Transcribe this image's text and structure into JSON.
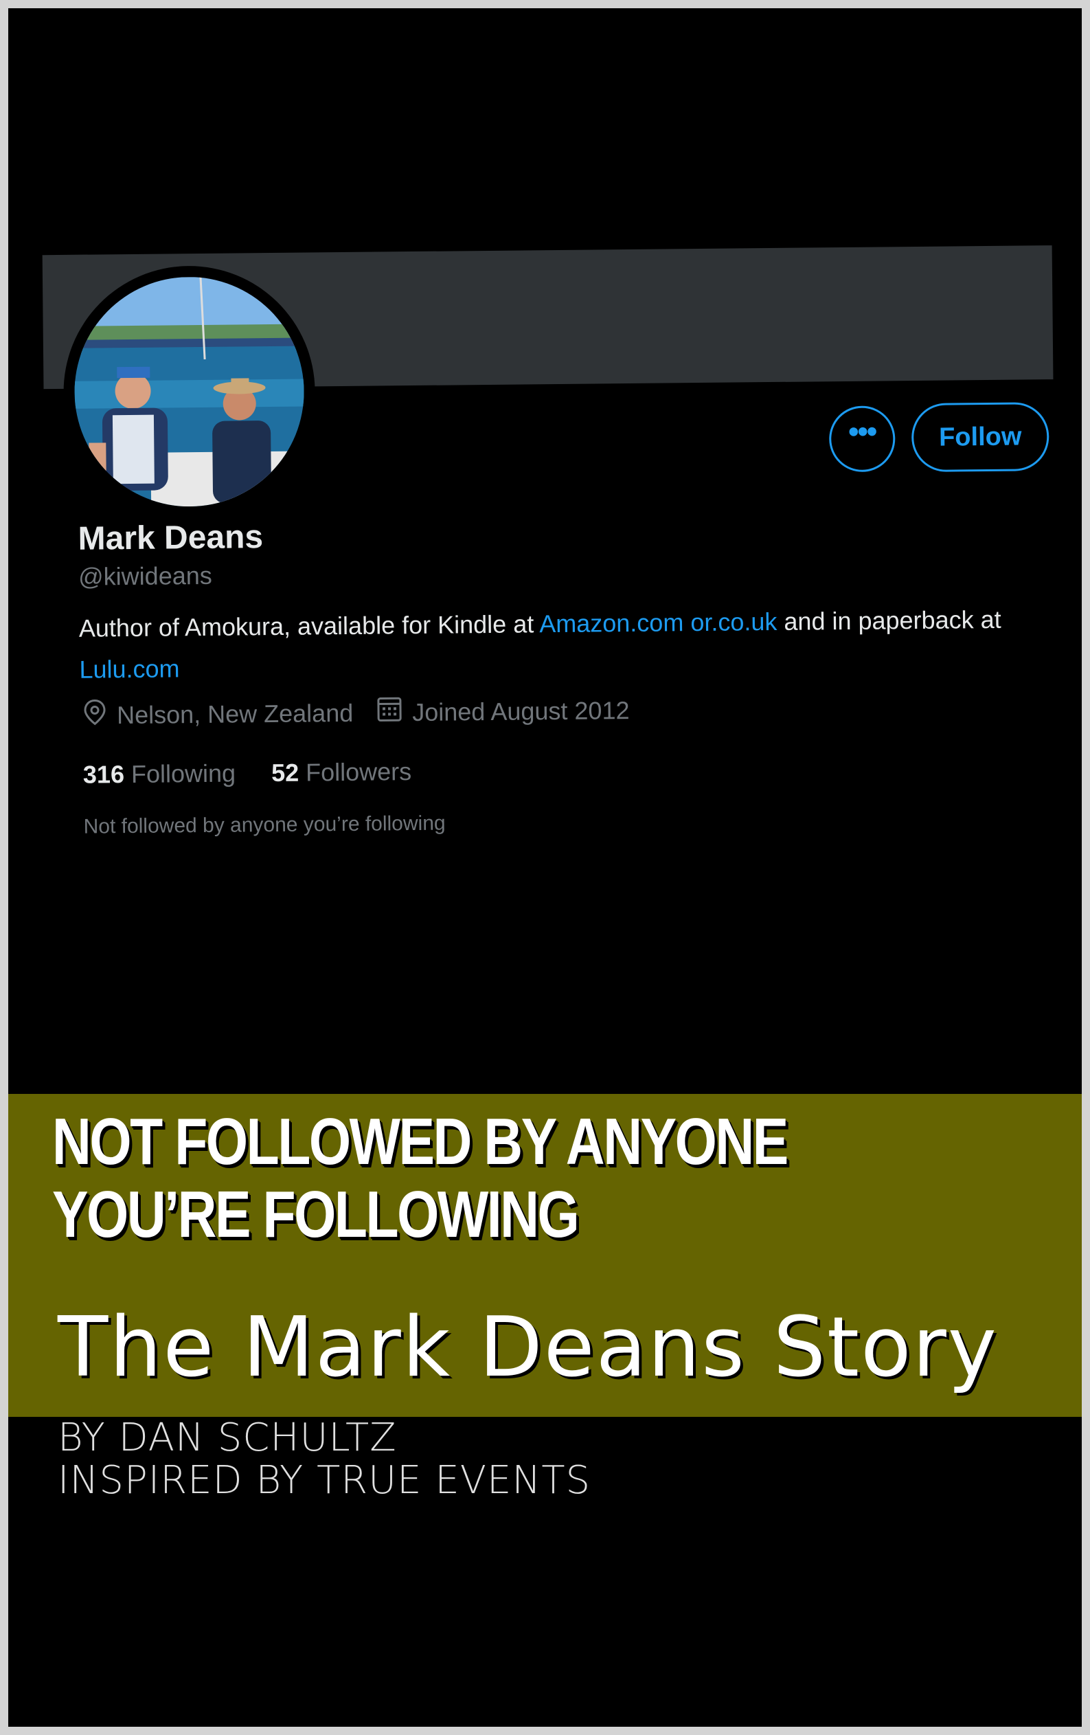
{
  "profile": {
    "name": "Mark Deans",
    "handle": "@kiwideans",
    "bio_prefix": "Author of Amokura, available for Kindle at ",
    "bio_link1": "Amazon.com",
    "bio_mid": " ",
    "bio_link2": "or.co.uk",
    "bio_suffix": " and in paperback at ",
    "bio_link3": "Lulu.com",
    "location": "Nelson, New Zealand",
    "joined": "Joined August 2012",
    "following_count": "316",
    "following_label": "Following",
    "followers_count": "52",
    "followers_label": "Followers",
    "mutual_text": "Not followed by anyone you’re following",
    "more_label": "•••",
    "follow_label": "Follow"
  },
  "cover": {
    "title": "NOT FOLLOWED BY ANYONE YOU’RE FOLLOWING",
    "subtitle": "The Mark Deans Story",
    "author": "BY DAN SCHULTZ",
    "tagline": "INSPIRED BY TRUE EVENTS"
  },
  "colors": {
    "accent": "#1d9bf0",
    "band": "#656401",
    "background": "#000000"
  },
  "icons": [
    "location-pin-icon",
    "calendar-icon",
    "more-icon"
  ]
}
